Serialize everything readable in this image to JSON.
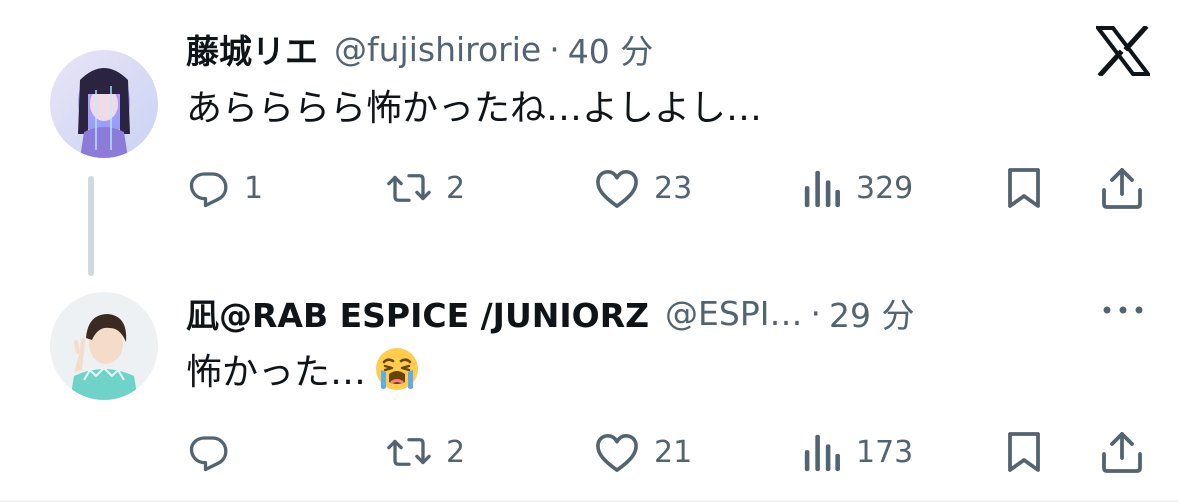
{
  "tweets": [
    {
      "name": "藤城リエ",
      "handle": "@fujishirorie",
      "separator": "·",
      "time": "40 分",
      "text": "あらららら怖かったね…よしよし…",
      "actions": {
        "reply_count": "1",
        "retweet_count": "2",
        "like_count": "23",
        "views_count": "329"
      }
    },
    {
      "name": "凪@RAB ESPICE /JUNIORZ",
      "handle": "@ESPI…",
      "separator": "·",
      "time": "29 分",
      "text": "怖かった…",
      "emoji": "loudly-crying-face",
      "actions": {
        "reply_count": "",
        "retweet_count": "2",
        "like_count": "21",
        "views_count": "173"
      }
    }
  ],
  "icons": {
    "brand": "x-logo",
    "overflow": "more-icon",
    "reply": "reply-icon",
    "retweet": "retweet-icon",
    "like": "like-icon",
    "views": "views-icon",
    "bookmark": "bookmark-icon",
    "share": "share-icon"
  },
  "colors": {
    "text_primary": "#0f1419",
    "text_secondary": "#536471",
    "thread_line": "#cfd9de",
    "background": "#ffffff"
  }
}
